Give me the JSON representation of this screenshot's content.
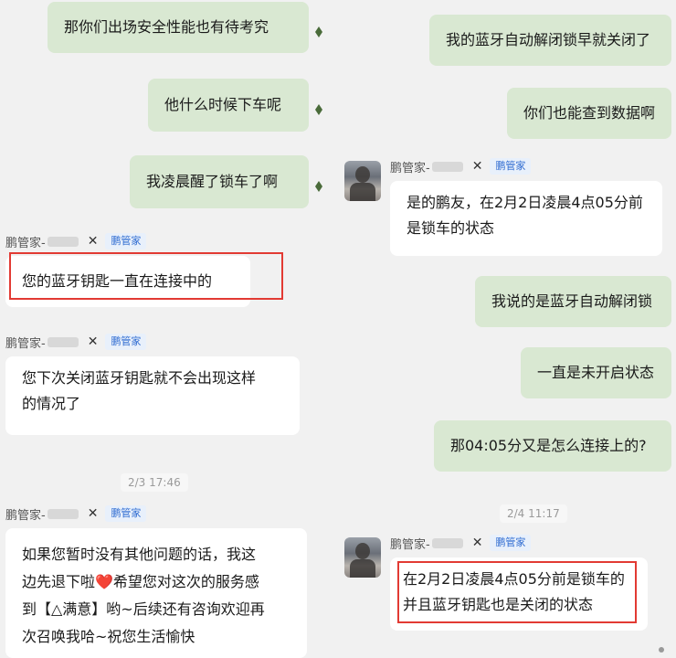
{
  "left": {
    "messages": [
      {
        "text": "那你们出场安全性能也有待考究"
      },
      {
        "text": "他什么时候下车呢"
      },
      {
        "text": "我凌晨醒了锁车了啊"
      },
      {
        "text": "您的蓝牙钥匙一直在连接中的"
      },
      {
        "text_lines": [
          "您下次关闭蓝牙钥匙就不会出现这样",
          "的情况了"
        ]
      },
      {
        "text_lines": [
          "如果您暂时没有其他问题的话，我这",
          "边先退下啦❤️希望您对这次的服务感",
          "到【△满意】哟~后续还有咨询欢迎再",
          "次召唤我哈~祝您生活愉快"
        ]
      }
    ],
    "sender_name": "鹏管家-",
    "sender_tag": "鹏管家",
    "timestamp": "2/3 17:46"
  },
  "right": {
    "messages": [
      {
        "text": "我的蓝牙自动解闭锁早就关闭了"
      },
      {
        "text": "你们也能查到数据啊"
      },
      {
        "text_lines": [
          "是的鹏友，在2月2日凌晨4点05分前",
          "是锁车的状态"
        ]
      },
      {
        "text": "我说的是蓝牙自动解闭锁"
      },
      {
        "text": "一直是未开启状态"
      },
      {
        "text": "那04:05分又是怎么连接上的?"
      },
      {
        "text_lines": [
          "在2月2日凌晨4点05分前是锁车的",
          "并且蓝牙钥匙也是关闭的状态"
        ]
      }
    ],
    "sender_name": "鹏管家-",
    "sender_tag": "鹏管家",
    "timestamp": "2/4 11:17"
  },
  "icons": {
    "bowtie": "bowtie-icon",
    "avatar": "agent-avatar",
    "leaf": "leaf-icon"
  },
  "colors": {
    "outgoing_bubble": "#d9e8d2",
    "incoming_bubble": "#ffffff",
    "highlight_box": "#e23a33",
    "tag_blue": "#2e6bd1"
  }
}
